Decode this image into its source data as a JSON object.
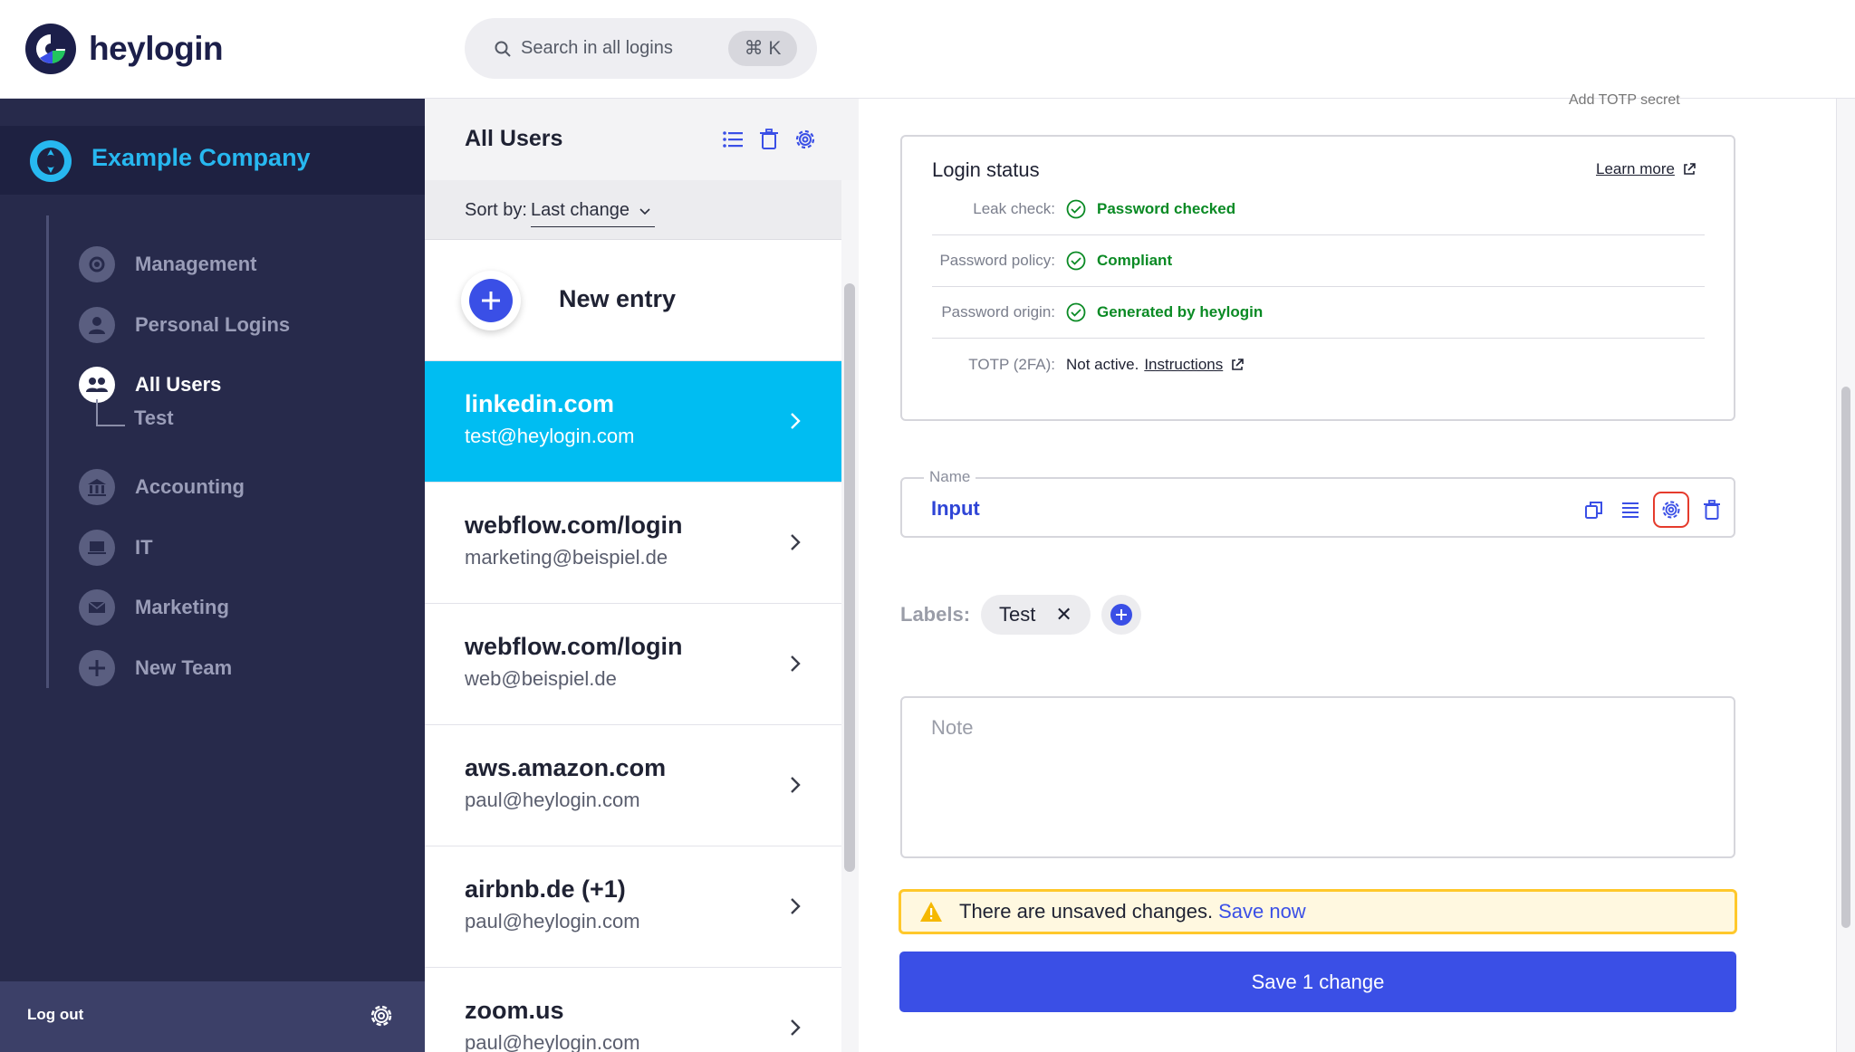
{
  "brand": {
    "name": "heylogin",
    "accent": "#3a4fe6",
    "highlight": "#00bdf2"
  },
  "search": {
    "placeholder": "Search in all logins",
    "shortcut": "⌘ K",
    "icon": "search-icon"
  },
  "sidebar": {
    "company": "Example Company",
    "items": [
      {
        "label": "Management",
        "icon": "gear-icon"
      },
      {
        "label": "Personal Logins",
        "icon": "user-icon"
      },
      {
        "label": "All Users",
        "icon": "users-icon",
        "active": true
      },
      {
        "label": "Accounting",
        "icon": "bank-icon"
      },
      {
        "label": "IT",
        "icon": "laptop-icon"
      },
      {
        "label": "Marketing",
        "icon": "envelope-icon"
      },
      {
        "label": "New Team",
        "icon": "plus-icon"
      }
    ],
    "sub_item": "Test",
    "logout": "Log out"
  },
  "list": {
    "title": "All Users",
    "sort_label": "Sort by:",
    "sort_value": "Last change",
    "new_entry": "New entry",
    "entries": [
      {
        "title": "linkedin.com",
        "sub": "test@heylogin.com",
        "selected": true
      },
      {
        "title": "webflow.com/login",
        "sub": "marketing@beispiel.de"
      },
      {
        "title": "webflow.com/login",
        "sub": "web@beispiel.de"
      },
      {
        "title": "aws.amazon.com",
        "sub": "paul@heylogin.com"
      },
      {
        "title": "airbnb.de (+1)",
        "sub": "paul@heylogin.com"
      },
      {
        "title": "zoom.us",
        "sub": "paul@heylogin.com"
      }
    ]
  },
  "detail": {
    "cut_text": "Add TOTP secret",
    "status": {
      "title": "Login status",
      "learn_more": "Learn more",
      "leak_key": "Leak check:",
      "leak_val": "Password checked",
      "policy_key": "Password policy:",
      "policy_val": "Compliant",
      "origin_key": "Password origin:",
      "origin_val": "Generated by heylogin",
      "totp_key": "TOTP (2FA):",
      "totp_val": "Not active.",
      "totp_link": "Instructions"
    },
    "name_field": {
      "legend": "Name",
      "value": "Input"
    },
    "labels": {
      "key": "Labels:",
      "chips": [
        "Test"
      ]
    },
    "note": {
      "placeholder": "Note"
    },
    "warning": {
      "text": "There are unsaved changes.",
      "link": "Save now"
    },
    "save_button": "Save 1 change"
  }
}
